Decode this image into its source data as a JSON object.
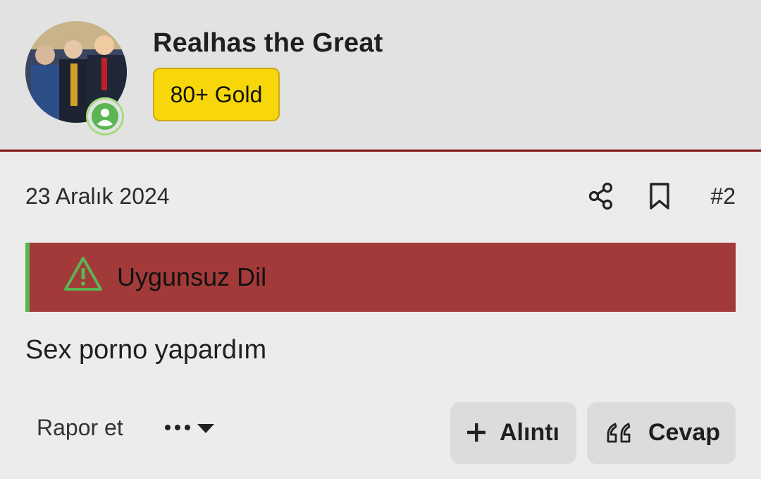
{
  "user": {
    "name": "Realhas the Great",
    "rank_badge": "80+ Gold",
    "online_icon": "user-circle-icon",
    "online_color": "#5ab552"
  },
  "post": {
    "date": "23 Aralık 2024",
    "number": "#2",
    "warning": {
      "icon": "warning-triangle-icon",
      "label": "Uygunsuz Dil",
      "background": "#a33a3a",
      "accent": "#5ab552"
    },
    "body": "Sex porno yapardım"
  },
  "toolbar": {
    "share_icon": "share-icon",
    "bookmark_icon": "bookmark-icon"
  },
  "actions": {
    "report_label": "Rapor et",
    "more_icon": "ellipsis-dropdown-icon",
    "quote_label": "Alıntı",
    "quote_icon": "plus-icon",
    "reply_label": "Cevap",
    "reply_icon": "quote-icon"
  },
  "colors": {
    "header_bg": "#e2e2e2",
    "header_border": "#7a1010",
    "badge_bg": "#f7d70a",
    "page_bg": "#ececec"
  }
}
